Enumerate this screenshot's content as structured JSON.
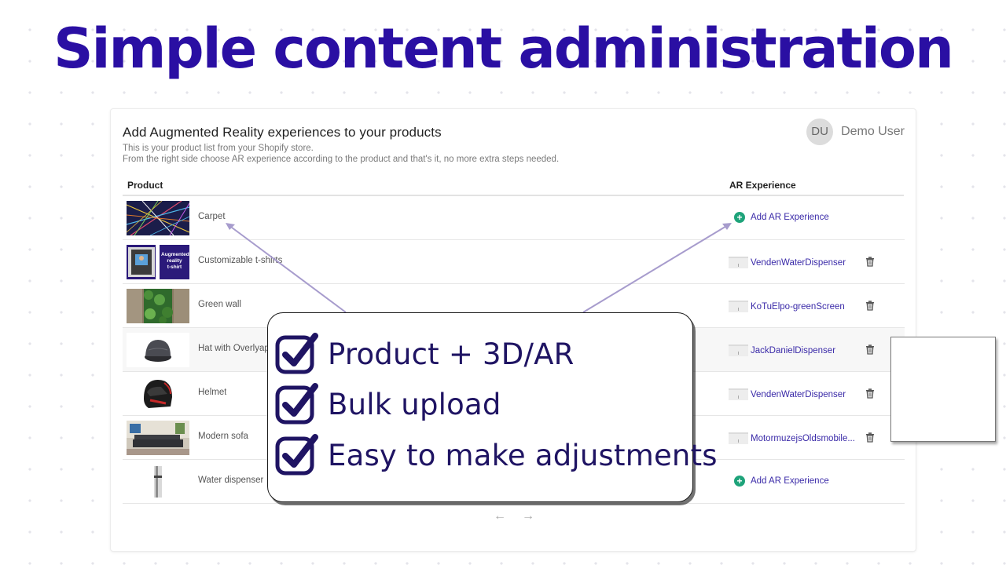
{
  "headline": "Simple content administration",
  "card": {
    "title": "Add Augmented Reality experiences to your products",
    "subtitle_1": "This is your product list from your Shopify store.",
    "subtitle_2": "From the right side choose AR experience according to the product and that's it, no more extra steps needed."
  },
  "user": {
    "initials": "DU",
    "name": "Demo User"
  },
  "table": {
    "col_product": "Product",
    "col_ar": "AR Experience",
    "add_label": "Add AR Experience",
    "rows": [
      {
        "name": "Carpet",
        "experience": null
      },
      {
        "name": "Customizable t-shirts",
        "experience": "VendenWaterDispenser"
      },
      {
        "name": "Green wall",
        "experience": "KoTuElpo-greenScreen"
      },
      {
        "name": "Hat with Overlyap",
        "experience": "JackDanielDispenser"
      },
      {
        "name": "Helmet",
        "experience": "VendenWaterDispenser"
      },
      {
        "name": "Modern sofa",
        "experience": "MotormuzejsOldsmobile..."
      },
      {
        "name": "Water dispenser",
        "experience": null
      }
    ],
    "tshirt_thumb_text": [
      "Augmented",
      "reality",
      "t-shirt"
    ]
  },
  "pagination": {
    "prev": "←",
    "next": "→"
  },
  "callout": {
    "features": [
      "Product + 3D/AR",
      "Bulk upload",
      "Easy to make adjustments"
    ]
  },
  "colors": {
    "headline": "#2a0fa3",
    "link": "#3a2aa8",
    "add_icon": "#1ea37a",
    "callout_text": "#1f1463",
    "arrow": "#a79ccd"
  },
  "icons": {
    "add": "plus-circle-icon",
    "delete": "trash-icon",
    "check": "checkbox-checked-icon",
    "prev": "arrow-left-icon",
    "next": "arrow-right-icon"
  }
}
